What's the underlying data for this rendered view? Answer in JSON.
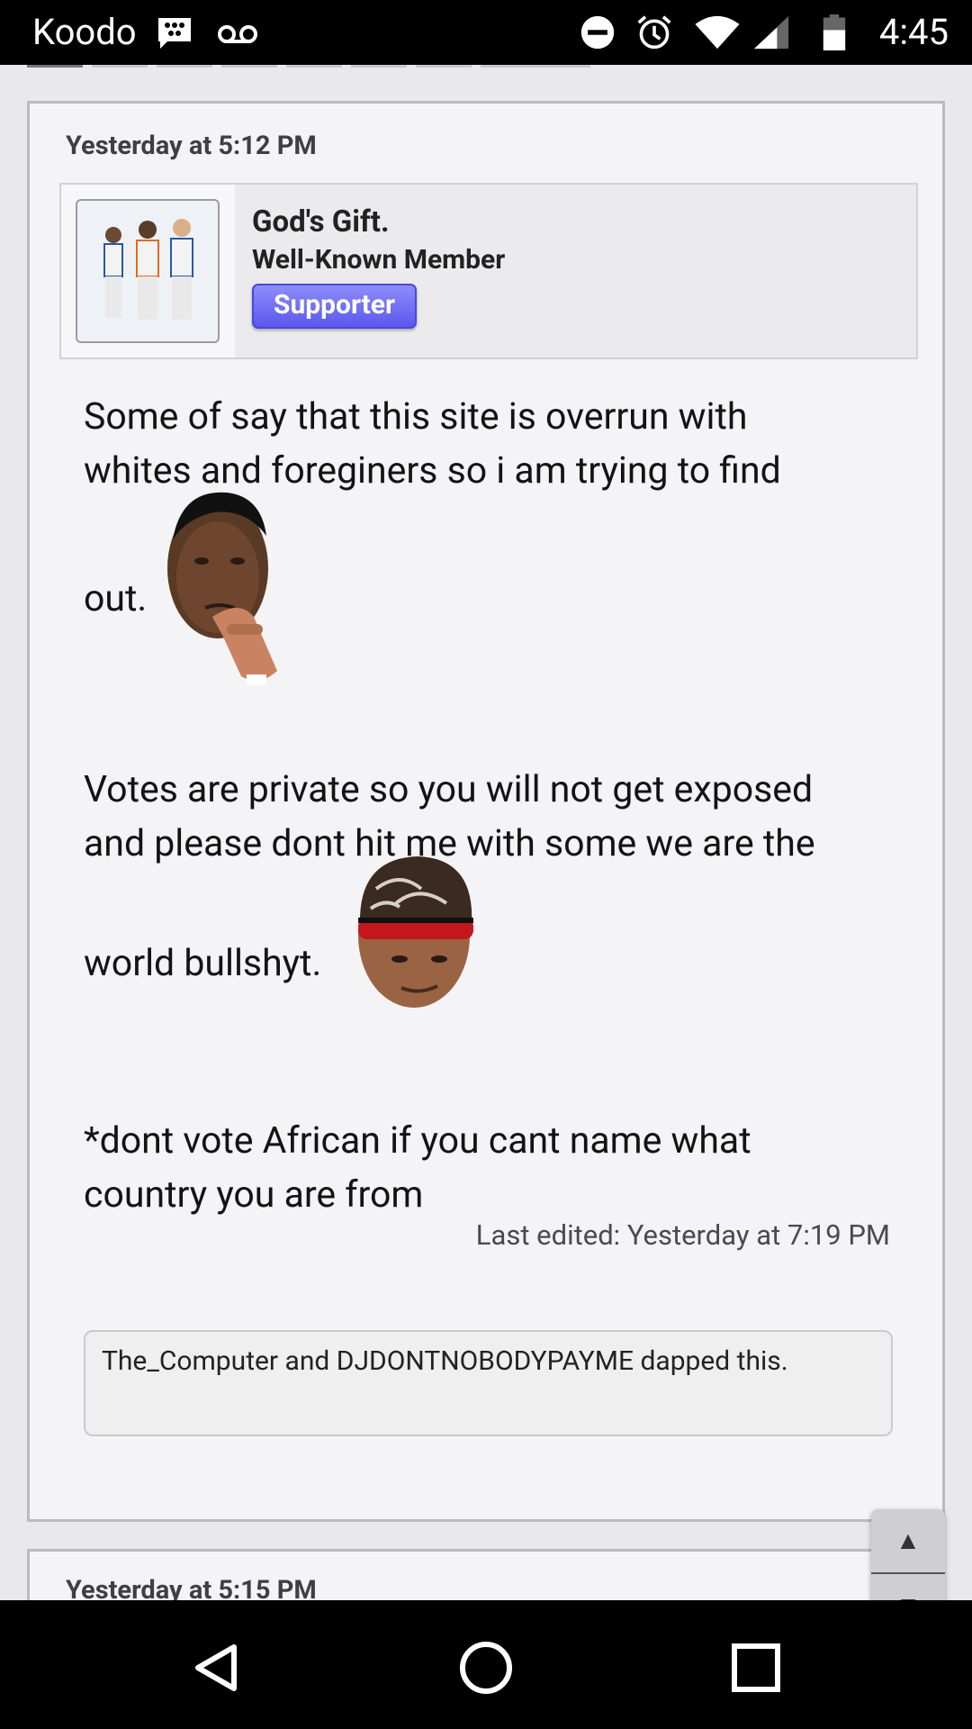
{
  "status_bar": {
    "carrier": "Koodo",
    "time": "4:45",
    "icons": [
      "bbm-icon",
      "voicemail-icon",
      "do-not-disturb-icon",
      "alarm-icon",
      "wifi-icon",
      "signal-icon",
      "battery-icon"
    ]
  },
  "post": {
    "date": "Yesterday at 5:12 PM",
    "username": "God's Gift.",
    "user_title": "Well-Known Member",
    "badge": "Supporter",
    "paragraph1_line1": "Some of say that this site is overrun with",
    "paragraph1_line2": "whites and foreginers so i am trying to find",
    "paragraph1_line3": "out.",
    "paragraph2_line1": "Votes are private so you will not get exposed",
    "paragraph2_line2": "and please dont hit me with some we are the",
    "paragraph2_line3": "world bullshyt.",
    "paragraph3_line1": "*dont vote African if you cant name what",
    "paragraph3_line2": "country you are from",
    "last_edited": "Last edited: Yesterday at 7:19 PM",
    "likes": "The_Computer and DJDONTNOBODYPAYME dapped this."
  },
  "next_post": {
    "date": "Yesterday at 5:15 PM"
  },
  "scroll_controls": {
    "up": "▲",
    "down": "▼"
  },
  "nav_bar": {
    "buttons": [
      "back-icon",
      "home-icon",
      "recents-icon"
    ]
  },
  "colors": {
    "badge": "#6a68f2",
    "post_bg": "#f4f4f6",
    "border": "#b9bbbf"
  }
}
